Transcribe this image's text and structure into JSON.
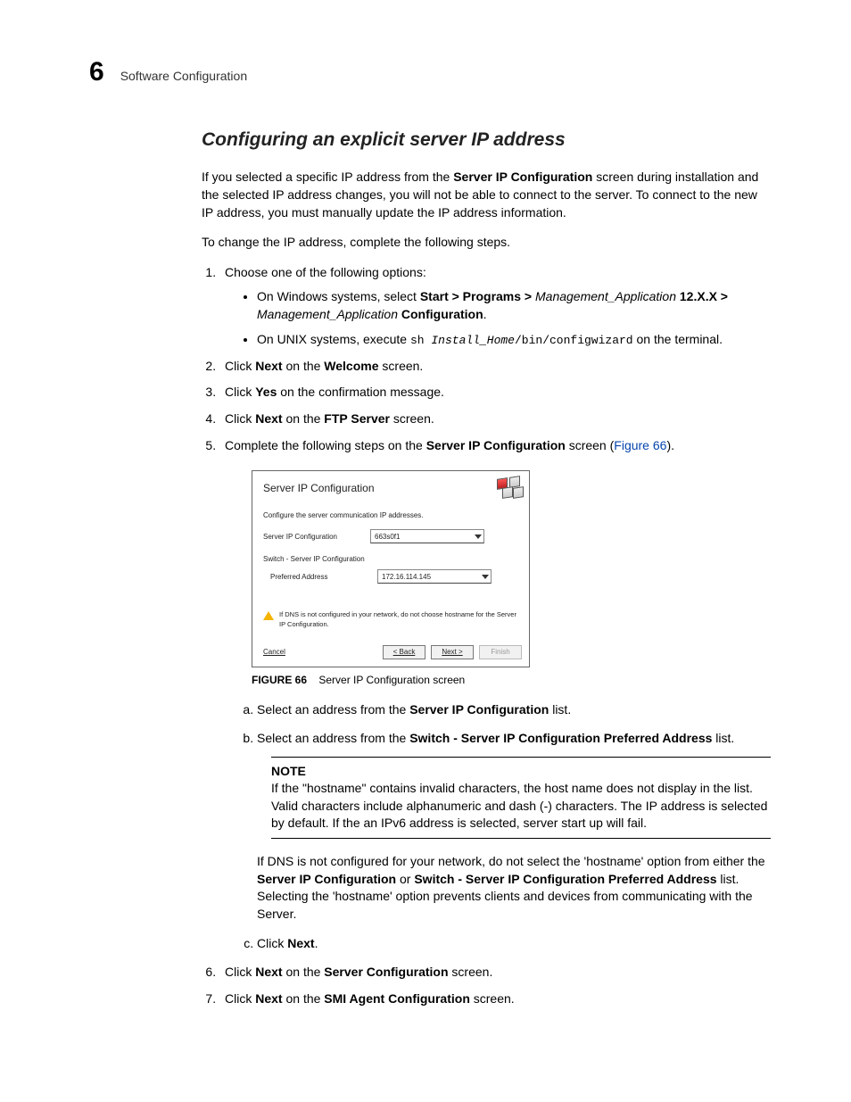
{
  "header": {
    "chapter_number": "6",
    "chapter_title": "Software Configuration"
  },
  "section_title": "Configuring an explicit server IP address",
  "intro": {
    "p1_a": "If you selected a specific IP address from the ",
    "p1_b": "Server IP Configuration",
    "p1_c": " screen during installation and the selected IP address changes, you will not be able to connect to the server. To connect to the new IP address, you must manually update the IP address information.",
    "p2": "To change the IP address, complete the following steps."
  },
  "steps": {
    "s1": "Choose one of the following options:",
    "s1_win_a": "On Windows systems, select ",
    "s1_win_b": "Start > Programs > ",
    "s1_win_c": "Management_Application",
    "s1_win_d": " 12.X.X > ",
    "s1_win_e": "Management_Application",
    "s1_win_f": " Configuration",
    "s1_win_g": ".",
    "s1_unix_a": "On UNIX systems, execute ",
    "s1_unix_b": "sh ",
    "s1_unix_c": "Install_Home",
    "s1_unix_d": "/bin/configwizard",
    "s1_unix_e": " on the terminal.",
    "s2_a": "Click ",
    "s2_b": "Next",
    "s2_c": " on the ",
    "s2_d": "Welcome",
    "s2_e": " screen.",
    "s3_a": "Click ",
    "s3_b": "Yes",
    "s3_c": " on the confirmation message.",
    "s4_a": "Click ",
    "s4_b": "Next",
    "s4_c": " on the ",
    "s4_d": "FTP Server",
    "s4_e": " screen.",
    "s5_a": "Complete the following steps on the ",
    "s5_b": "Server IP Configuration",
    "s5_c": " screen (",
    "s5_link": "Figure 66",
    "s5_d": ").",
    "s5a_a": "Select an address from the ",
    "s5a_b": "Server IP Configuration",
    "s5a_c": " list.",
    "s5b_a": "Select an address from the ",
    "s5b_b": "Switch - Server IP Configuration Preferred Address",
    "s5b_c": " list.",
    "note_h": "NOTE",
    "note_body": "If the \"hostname\" contains invalid characters, the host name does not display in the list. Valid characters include alphanumeric and dash (-) characters. The IP address is selected by default. If the an IPv6 address is selected, server start up will fail.",
    "note2_a": "If DNS is not configured for your network, do not select the 'hostname' option from either the ",
    "note2_b": "Server IP Configuration",
    "note2_c": " or ",
    "note2_d": "Switch - Server IP Configuration Preferred Address",
    "note2_e": " list. Selecting the 'hostname' option prevents clients and devices from communicating with the Server.",
    "s5c_a": "Click ",
    "s5c_b": "Next",
    "s5c_c": ".",
    "s6_a": "Click ",
    "s6_b": "Next",
    "s6_c": " on the ",
    "s6_d": "Server Configuration",
    "s6_e": " screen.",
    "s7_a": "Click ",
    "s7_b": "Next",
    "s7_c": " on the ",
    "s7_d": "SMI Agent Configuration",
    "s7_e": " screen."
  },
  "dialog": {
    "title": "Server IP Configuration",
    "instruct": "Configure the server communication IP addresses.",
    "row1_label": "Server IP Configuration",
    "row1_value": "663s0f1",
    "section2": "Switch - Server IP Configuration",
    "row2_label": "Preferred Address",
    "row2_value": "172.16.114.145",
    "warn": "If DNS is not configured in your network, do not choose hostname for the Server IP Configuration.",
    "btn_cancel": "Cancel",
    "btn_back": "< Back",
    "btn_next": "Next >",
    "btn_finish": "Finish"
  },
  "figure": {
    "label": "FIGURE 66",
    "caption": "Server IP Configuration screen"
  }
}
